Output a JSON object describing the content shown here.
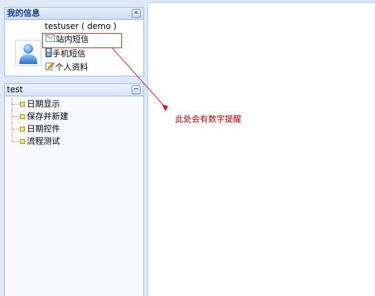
{
  "info_panel": {
    "title": "我的信息",
    "collapse_icon": "double-chevron-left-icon",
    "username": "testuser ( demo )",
    "links": [
      {
        "label": "站内短信",
        "icon": "envelope-icon"
      },
      {
        "label": "手机短信",
        "icon": "mobile-phone-icon"
      },
      {
        "label": "个人资料",
        "icon": "edit-note-icon"
      }
    ]
  },
  "test_panel": {
    "title": "test",
    "collapse_icon": "minus-icon",
    "items": [
      "日期显示",
      "保存并新建",
      "日期控件",
      "流程测试"
    ]
  },
  "annotation": {
    "text": "此处会有数字提醒",
    "color": "#cc0000"
  },
  "colors": {
    "panel_border": "#99bbe8",
    "header_text": "#15428b",
    "highlight": "#d2242a"
  }
}
